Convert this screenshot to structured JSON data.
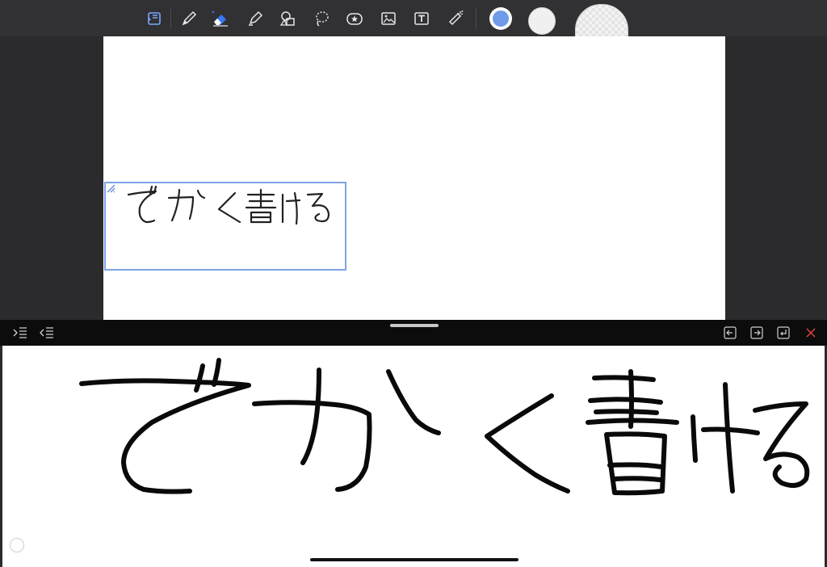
{
  "toolbar": {
    "tools": [
      {
        "name": "page-layout-icon"
      },
      {
        "name": "pen-icon"
      },
      {
        "name": "eraser-icon",
        "active": true
      },
      {
        "name": "highlighter-icon"
      },
      {
        "name": "shapes-icon"
      },
      {
        "name": "lasso-icon"
      },
      {
        "name": "sticker-icon"
      },
      {
        "name": "image-icon"
      },
      {
        "name": "text-box-icon"
      },
      {
        "name": "laser-pointer-icon"
      }
    ],
    "current_color": "#6f9be8",
    "accent": "#3478f6"
  },
  "page": {
    "text_box": {
      "recognized_text": "でかく書ける"
    }
  },
  "handwriting_panel": {
    "left_buttons": [
      "indent-icon",
      "outdent-icon"
    ],
    "right_buttons": [
      "cursor-left-icon",
      "cursor-right-icon",
      "return-icon",
      "close-icon"
    ],
    "ink_text": "でかく書ける",
    "close_color": "#e0443a"
  }
}
